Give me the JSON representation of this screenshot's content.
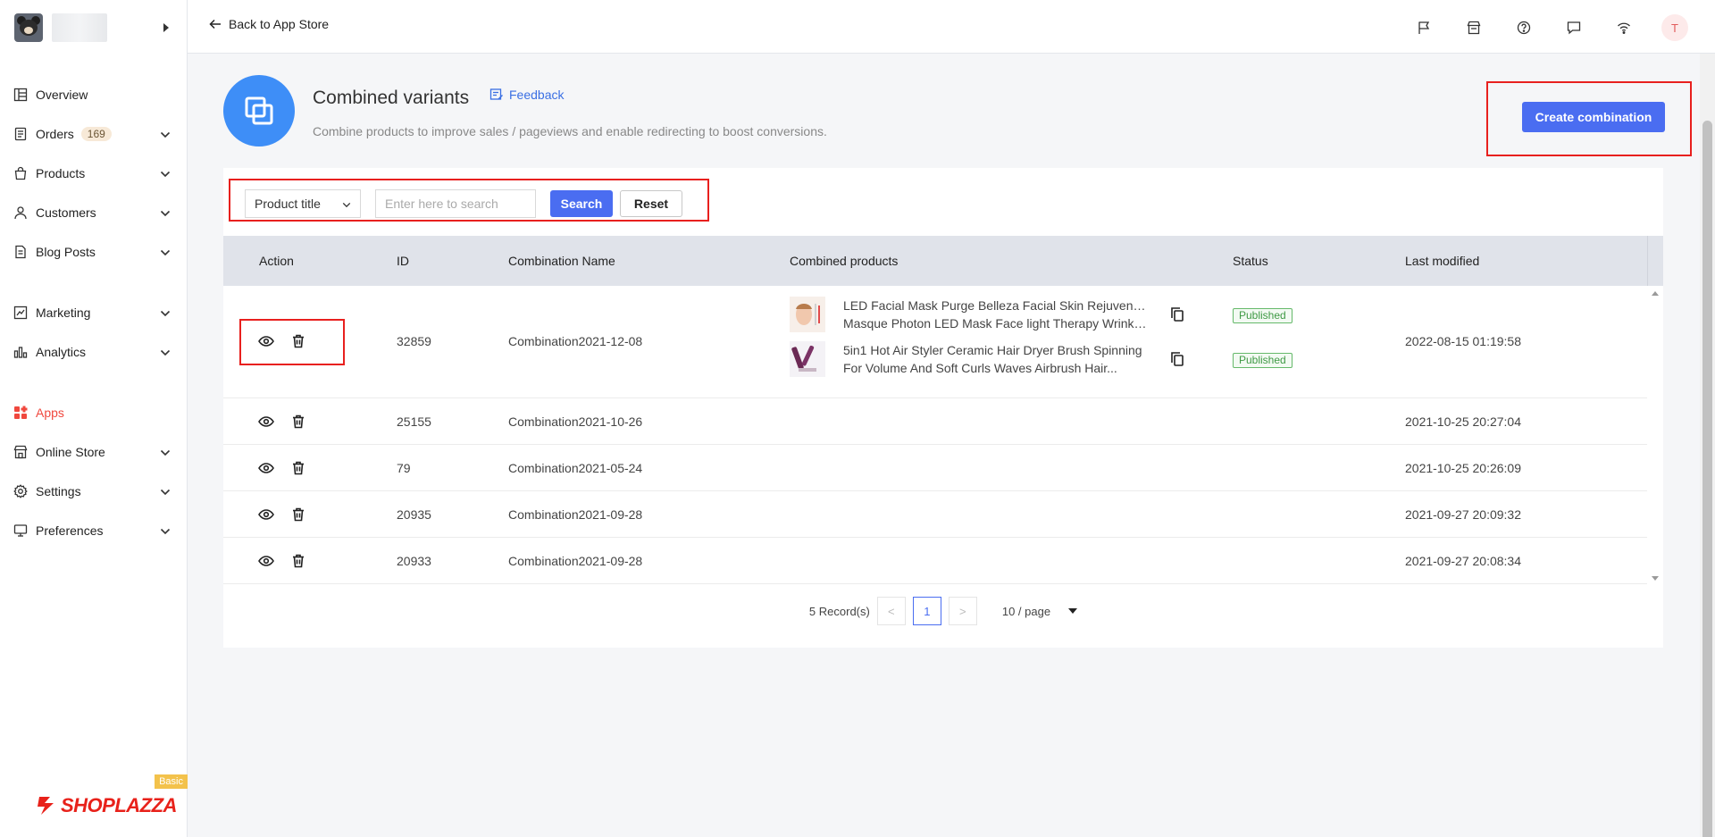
{
  "sidebar": {
    "items": [
      {
        "label": "Overview",
        "icon": "overview-icon"
      },
      {
        "label": "Orders",
        "icon": "orders-icon",
        "badge": "169"
      },
      {
        "label": "Products",
        "icon": "products-icon"
      },
      {
        "label": "Customers",
        "icon": "customers-icon"
      },
      {
        "label": "Blog Posts",
        "icon": "blog-icon"
      },
      {
        "label": "Marketing",
        "icon": "marketing-icon"
      },
      {
        "label": "Analytics",
        "icon": "analytics-icon"
      },
      {
        "label": "Apps",
        "icon": "apps-icon"
      },
      {
        "label": "Online Store",
        "icon": "store-icon"
      },
      {
        "label": "Settings",
        "icon": "gear-icon"
      },
      {
        "label": "Preferences",
        "icon": "monitor-icon"
      }
    ],
    "plan_badge": "Basic",
    "brand": "SHOPLAZZA"
  },
  "topbar": {
    "back_label": "Back to App Store",
    "user_initial": "T"
  },
  "header": {
    "title": "Combined variants",
    "feedback_label": "Feedback",
    "subtitle": "Combine products to improve sales / pageviews and enable redirecting to boost conversions.",
    "create_label": "Create combination"
  },
  "filters": {
    "field_select": "Product title",
    "search_placeholder": "Enter here to search",
    "search_label": "Search",
    "reset_label": "Reset"
  },
  "table": {
    "columns": [
      "Action",
      "ID",
      "Combination Name",
      "Combined products",
      "Status",
      "Last modified"
    ],
    "rows": [
      {
        "id": "32859",
        "name": "Combination2021-12-08",
        "products": [
          {
            "line1": "LED Facial Mask Purge Belleza Facial Skin Rejuvenation",
            "line2": "Masque Photon LED Mask Face light Therapy Wrinkle...",
            "status": "Published"
          },
          {
            "line1": "5in1 Hot Air Styler Ceramic Hair Dryer Brush Spinning",
            "line2": "For Volume And Soft Curls Waves Airbrush Hair...",
            "status": "Published"
          }
        ],
        "modified": "2022-08-15 01:19:58"
      },
      {
        "id": "25155",
        "name": "Combination2021-10-26",
        "modified": "2021-10-25 20:27:04"
      },
      {
        "id": "79",
        "name": "Combination2021-05-24",
        "modified": "2021-10-25 20:26:09"
      },
      {
        "id": "20935",
        "name": "Combination2021-09-28",
        "modified": "2021-09-27 20:09:32"
      },
      {
        "id": "20933",
        "name": "Combination2021-09-28",
        "modified": "2021-09-27 20:08:34"
      }
    ]
  },
  "pagination": {
    "total": "5 Record(s)",
    "prev": "<",
    "current": "1",
    "next": ">",
    "per_page": "10 / page"
  },
  "colors": {
    "accent": "#4a6df1",
    "highlight": "#e8201e",
    "active_nav": "#f0483e",
    "status_green": "#3f9a45"
  }
}
